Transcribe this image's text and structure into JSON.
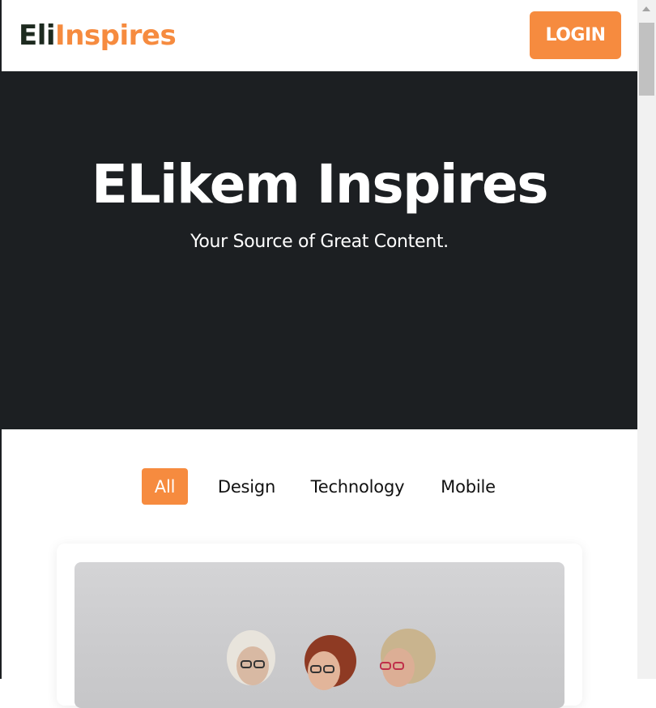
{
  "header": {
    "logo_part1": "Eli",
    "logo_part2": "Inspires",
    "login_label": "LOGIN"
  },
  "hero": {
    "title": "ELikem Inspires",
    "subtitle": "Your Source of Great Content."
  },
  "filters": [
    {
      "label": "All",
      "active": true
    },
    {
      "label": "Design",
      "active": false
    },
    {
      "label": "Technology",
      "active": false
    },
    {
      "label": "Mobile",
      "active": false
    }
  ],
  "colors": {
    "accent": "#f68b3f",
    "hero_bg": "#1c1f22",
    "logo_dark": "#1d2a1f"
  }
}
